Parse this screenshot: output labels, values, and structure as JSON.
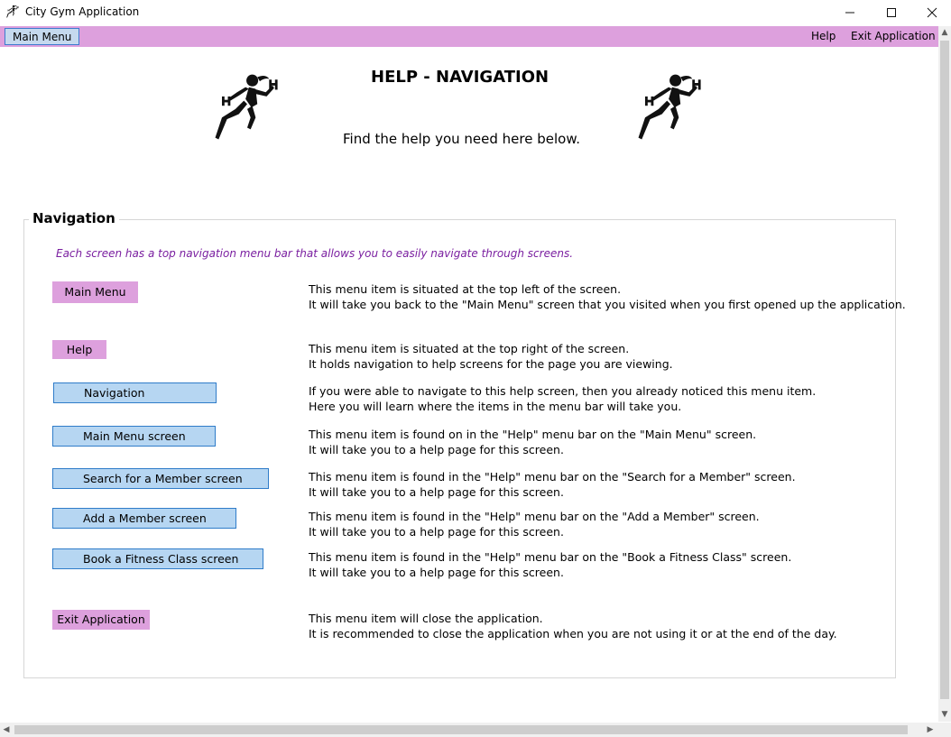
{
  "window": {
    "title": "City Gym Application",
    "controls": {
      "minimize": "—",
      "maximize": "☐",
      "close": "✕"
    }
  },
  "menubar": {
    "main_menu": "Main Menu",
    "help": "Help",
    "exit": "Exit Application"
  },
  "header": {
    "title": "HELP - NAVIGATION",
    "subtitle": "Find the help you need here below."
  },
  "section": {
    "title": "Navigation",
    "intro": "Each screen has a top navigation menu bar that allows you to easily navigate through screens.",
    "items": [
      {
        "label": "Main Menu",
        "style": "menu",
        "line1": "This menu item is situated at the top left of the screen.",
        "line2": "It will take you back to the \"Main Menu\" screen that you visited when you first opened up the application."
      },
      {
        "label": "Help",
        "style": "menu",
        "line1": "This menu item is situated at the top right of the screen.",
        "line2": "It holds navigation to help screens for the page you are viewing."
      },
      {
        "label": "Navigation",
        "style": "submenu",
        "line1": "If you were able to navigate to this help screen, then you already noticed this menu item.",
        "line2": "Here you will learn where the items in the menu bar will take you."
      },
      {
        "label": "Main Menu screen",
        "style": "submenu",
        "line1": "This menu item is found on in the \"Help\" menu bar on the \"Main Menu\" screen.",
        "line2": "It will take you to a help page for this screen."
      },
      {
        "label": "Search for a Member screen",
        "style": "submenu",
        "line1": "This menu item is found in the \"Help\" menu bar on the \"Search for a Member\" screen.",
        "line2": "It will take you to a help page for this screen."
      },
      {
        "label": "Add a Member screen",
        "style": "submenu",
        "line1": "This menu item is found in the \"Help\" menu bar on the \"Add a Member\" screen.",
        "line2": "It will take you to a help page for this screen."
      },
      {
        "label": "Book a Fitness Class screen",
        "style": "submenu",
        "line1": "This menu item is found in the \"Help\" menu bar on the \"Book a Fitness Class\" screen.",
        "line2": "It will take you to a help page for this screen."
      },
      {
        "label": "Exit Application",
        "style": "menu",
        "line1": "This menu item will close the application.",
        "line2": "It is recommended to close the application when you are not using it or at the end of the day."
      }
    ]
  },
  "colors": {
    "menubar": "#dda0dd",
    "submenu_fill": "#b6d6f2",
    "submenu_border": "#2f7cc9",
    "intro_text": "#7a1fa0"
  },
  "icons": [
    "runner-icon",
    "minimize-icon",
    "maximize-icon",
    "close-icon",
    "chevron-up-icon",
    "chevron-down-icon",
    "chevron-left-icon",
    "chevron-right-icon"
  ]
}
